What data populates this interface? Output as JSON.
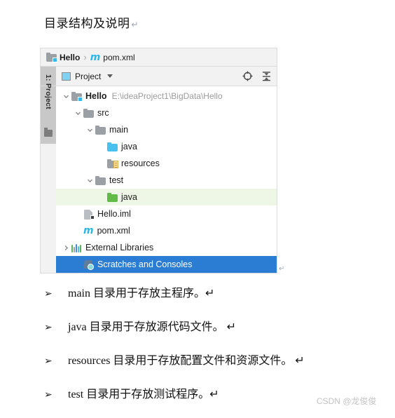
{
  "document": {
    "heading": "目录结构及说明",
    "pilcrow": "↵"
  },
  "ide": {
    "breadcrumb": {
      "module_icon": "module-folder-icon",
      "module": "Hello",
      "separator": "›",
      "file_icon": "maven-m-icon",
      "file": "pom.xml"
    },
    "toolwindow": {
      "stripe_label": "1: Project",
      "stripe_icon": "project-folder-icon",
      "title": "Project",
      "title_icon": "project-square-icon",
      "dropdown_icon": "chevron-down-icon",
      "actions": [
        {
          "name": "select-opened-file-icon",
          "tooltip": "Select Opened File"
        },
        {
          "name": "collapse-all-icon",
          "tooltip": "Collapse All"
        }
      ]
    },
    "tree": [
      {
        "label": "Hello",
        "path": "E:\\ideaProject1\\BigData\\Hello",
        "icon": "module-folder-icon",
        "indent": 0,
        "twisty": "expanded",
        "bold": true,
        "state": "none"
      },
      {
        "label": "src",
        "path": "",
        "icon": "folder-grey-icon",
        "indent": 1,
        "twisty": "expanded",
        "bold": false,
        "state": "none"
      },
      {
        "label": "main",
        "path": "",
        "icon": "folder-grey-icon",
        "indent": 2,
        "twisty": "expanded",
        "bold": false,
        "state": "none"
      },
      {
        "label": "java",
        "path": "",
        "icon": "folder-blue-sources-icon",
        "indent": 3,
        "twisty": "none",
        "bold": false,
        "state": "none"
      },
      {
        "label": "resources",
        "path": "",
        "icon": "folder-resources-icon",
        "indent": 3,
        "twisty": "none",
        "bold": false,
        "state": "none"
      },
      {
        "label": "test",
        "path": "",
        "icon": "folder-grey-icon",
        "indent": 2,
        "twisty": "expanded",
        "bold": false,
        "state": "none"
      },
      {
        "label": "java",
        "path": "",
        "icon": "folder-green-test-icon",
        "indent": 3,
        "twisty": "none",
        "bold": false,
        "state": "hover-green"
      },
      {
        "label": "Hello.iml",
        "path": "",
        "icon": "iml-file-icon",
        "indent": 1,
        "twisty": "none",
        "bold": false,
        "state": "none"
      },
      {
        "label": "pom.xml",
        "path": "",
        "icon": "maven-m-icon",
        "indent": 1,
        "twisty": "none",
        "bold": false,
        "state": "none"
      },
      {
        "label": "External Libraries",
        "path": "",
        "icon": "external-libraries-icon",
        "indent": 0,
        "twisty": "collapsed",
        "bold": false,
        "state": "none"
      },
      {
        "label": "Scratches and Consoles",
        "path": "",
        "icon": "scratches-icon",
        "indent": 1,
        "twisty": "none",
        "bold": false,
        "state": "selected-blue"
      }
    ],
    "trailing_pilcrow": "↵"
  },
  "bullets": [
    {
      "marker": "➢",
      "text": "main 目录用于存放主程序。↵"
    },
    {
      "marker": "➢",
      "text": "java 目录用于存放源代码文件。 ↵"
    },
    {
      "marker": "➢",
      "text": "resources 目录用于存放配置文件和资源文件。 ↵"
    },
    {
      "marker": "➢",
      "text": "test 目录用于存放测试程序。↵"
    }
  ],
  "watermark": "CSDN @龙俊俊",
  "colors": {
    "selection_blue": "#2b7cd3",
    "hover_green": "#eef7e5",
    "sources_blue": "#49c1ef",
    "test_green": "#62bb46",
    "folder_grey": "#9aa0a6",
    "maven_cyan": "#29b6e8",
    "panel_grey": "#f2f2f2",
    "stripe_grey": "#c8c8c8"
  }
}
